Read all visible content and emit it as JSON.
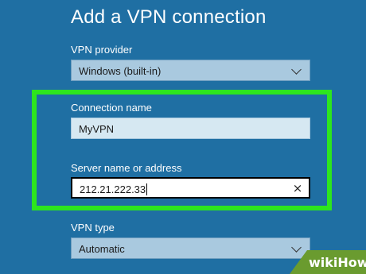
{
  "page": {
    "title": "Add a VPN connection"
  },
  "vpn_provider": {
    "label": "VPN provider",
    "value": "Windows (built-in)"
  },
  "connection_name": {
    "label": "Connection name",
    "value": "MyVPN"
  },
  "server": {
    "label": "Server name or address",
    "value": "212.21.222.33"
  },
  "vpn_type": {
    "label": "VPN type",
    "value": "Automatic"
  },
  "icons": {
    "dropdown": "chevron-down-icon",
    "clear": "close-icon"
  },
  "colors": {
    "background": "#1f6fa3",
    "highlight": "#2de51e",
    "watermark": "#6a9b2f"
  },
  "watermark": {
    "text": "wikiHow"
  }
}
